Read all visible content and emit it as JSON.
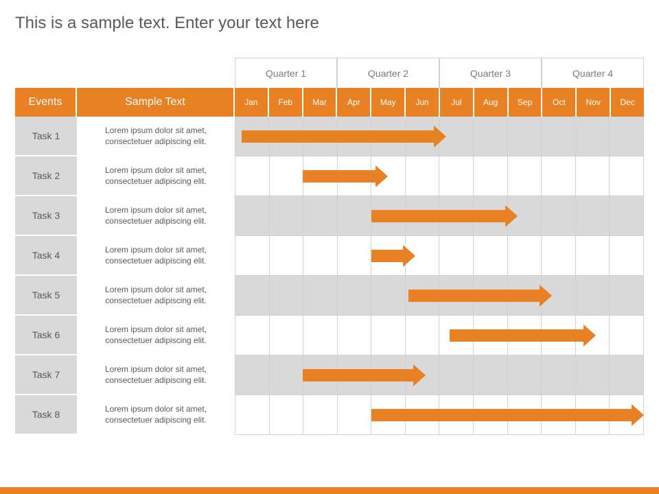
{
  "title": "This is a sample text. Enter your text here",
  "headers": {
    "events": "Events",
    "sample": "Sample Text"
  },
  "quarters": [
    "Quarter 1",
    "Quarter 2",
    "Quarter 3",
    "Quarter 4"
  ],
  "months": [
    "Jan",
    "Feb",
    "Mar",
    "Apr",
    "May",
    "Jun",
    "Jul",
    "Aug",
    "Sep",
    "Oct",
    "Nov",
    "Dec"
  ],
  "tasks": [
    {
      "name": "Task 1",
      "note": "Lorem ipsum dolor sit amet, consectetuer adipiscing elit."
    },
    {
      "name": "Task 2",
      "note": "Lorem ipsum dolor sit amet, consectetuer adipiscing elit."
    },
    {
      "name": "Task 3",
      "note": "Lorem ipsum dolor sit amet, consectetuer adipiscing elit."
    },
    {
      "name": "Task 4",
      "note": "Lorem ipsum dolor sit amet, consectetuer adipiscing elit."
    },
    {
      "name": "Task 5",
      "note": "Lorem ipsum dolor sit amet, consectetuer adipiscing elit."
    },
    {
      "name": "Task 6",
      "note": "Lorem ipsum dolor sit amet, consectetuer adipiscing elit."
    },
    {
      "name": "Task 7",
      "note": "Lorem ipsum dolor sit amet, consectetuer adipiscing elit."
    },
    {
      "name": "Task 8",
      "note": "Lorem ipsum dolor sit amet, consectetuer adipiscing elit."
    }
  ],
  "chart_data": {
    "type": "gantt",
    "title": "This is a sample text. Enter your text here",
    "categories": [
      "Jan",
      "Feb",
      "Mar",
      "Apr",
      "May",
      "Jun",
      "Jul",
      "Aug",
      "Sep",
      "Oct",
      "Nov",
      "Dec"
    ],
    "series": [
      {
        "name": "Task 1",
        "start": 0.2,
        "end": 6.2
      },
      {
        "name": "Task 2",
        "start": 2.0,
        "end": 4.5
      },
      {
        "name": "Task 3",
        "start": 4.0,
        "end": 8.3
      },
      {
        "name": "Task 4",
        "start": 4.0,
        "end": 5.3
      },
      {
        "name": "Task 5",
        "start": 5.1,
        "end": 9.3
      },
      {
        "name": "Task 6",
        "start": 6.3,
        "end": 10.6
      },
      {
        "name": "Task 7",
        "start": 2.0,
        "end": 5.6
      },
      {
        "name": "Task 8",
        "start": 4.0,
        "end": 12.0
      }
    ],
    "xlim": [
      0,
      12
    ],
    "colors": {
      "accent": "#e88024",
      "grid": "#d0d0d0",
      "altRow": "#d9d9d9",
      "text": "#595959"
    }
  }
}
